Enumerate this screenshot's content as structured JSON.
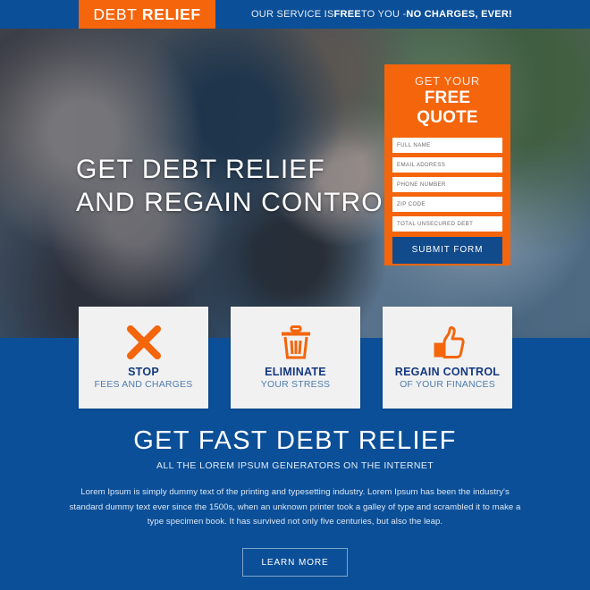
{
  "header": {
    "logo_light": "DEBT",
    "logo_bold": "RELIEF",
    "tagline_pre": "OUR SERVICE IS ",
    "tagline_bold1": "FREE",
    "tagline_mid": " TO YOU - ",
    "tagline_bold2": "NO CHARGES, EVER!"
  },
  "hero": {
    "headline_line1": "GET DEBT RELIEF",
    "headline_line2": "AND REGAIN CONTROL"
  },
  "quote_form": {
    "title_small": "GET YOUR",
    "title_large": "FREE QUOTE",
    "fields": [
      {
        "name": "full-name",
        "placeholder": "FULL NAME",
        "value": ""
      },
      {
        "name": "email-address",
        "placeholder": "EMAIL ADDRESS",
        "value": ""
      },
      {
        "name": "phone-number",
        "placeholder": "PHONE NUMBER",
        "value": ""
      },
      {
        "name": "zip-code",
        "placeholder": "ZIP CODE",
        "value": ""
      },
      {
        "name": "total-unsecured-debt",
        "placeholder": "TOTAL UNSECURED DEBT",
        "value": ""
      }
    ],
    "submit_label": "SUBMIT FORM"
  },
  "cards": [
    {
      "icon": "cross-x-icon",
      "title": "STOP",
      "subtitle": "FEES AND CHARGES"
    },
    {
      "icon": "trash-can-icon",
      "title": "ELIMINATE",
      "subtitle": "YOUR STRESS"
    },
    {
      "icon": "thumbs-up-icon",
      "title": "REGAIN CONTROL",
      "subtitle": "OF YOUR FINANCES"
    }
  ],
  "bottom": {
    "title": "GET FAST DEBT RELIEF",
    "subtitle": "ALL THE LOREM IPSUM GENERATORS ON THE INTERNET",
    "body": "Lorem Ipsum is simply dummy text of the printing and typesetting industry. Lorem Ipsum has been the industry's standard dummy text ever since the 1500s, when an unknown printer took a galley of type and scrambled it to make a type specimen book. It has survived not only five centuries, but also the leap.",
    "learn_more_label": "LEARN MORE"
  },
  "colors": {
    "brand_blue": "#0b4f98",
    "brand_orange": "#f4650c",
    "button_blue": "#114b8c",
    "card_bg": "#f1f1f1",
    "card_title": "#15387e",
    "card_subtitle": "#4f7dad"
  }
}
